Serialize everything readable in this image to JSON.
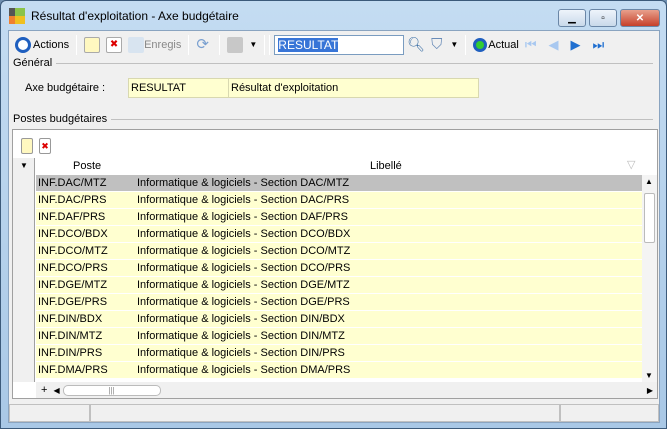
{
  "window": {
    "title": "Résultat d'exploitation -  Axe budgétaire"
  },
  "toolbar": {
    "actions": "Actions",
    "save": "Enregis",
    "search_value": "RESULTAT",
    "actual": "Actual"
  },
  "general": {
    "label": "Général",
    "axe_label": "Axe budgétaire :",
    "axe_code": "RESULTAT",
    "axe_name": "Résultat d'exploitation"
  },
  "postes": {
    "label": "Postes budgétaires",
    "columns": [
      "Poste",
      "Libellé"
    ],
    "rows": [
      [
        "INF.DAC/MTZ",
        "Informatique & logiciels - Section DAC/MTZ"
      ],
      [
        "INF.DAC/PRS",
        "Informatique & logiciels - Section DAC/PRS"
      ],
      [
        "INF.DAF/PRS",
        "Informatique & logiciels - Section DAF/PRS"
      ],
      [
        "INF.DCO/BDX",
        "Informatique & logiciels - Section DCO/BDX"
      ],
      [
        "INF.DCO/MTZ",
        "Informatique & logiciels - Section DCO/MTZ"
      ],
      [
        "INF.DCO/PRS",
        "Informatique & logiciels - Section DCO/PRS"
      ],
      [
        "INF.DGE/MTZ",
        "Informatique & logiciels - Section DGE/MTZ"
      ],
      [
        "INF.DGE/PRS",
        "Informatique & logiciels - Section DGE/PRS"
      ],
      [
        "INF.DIN/BDX",
        "Informatique & logiciels - Section DIN/BDX"
      ],
      [
        "INF.DIN/MTZ",
        "Informatique & logiciels - Section DIN/MTZ"
      ],
      [
        "INF.DIN/PRS",
        "Informatique & logiciels - Section DIN/PRS"
      ],
      [
        "INF.DMA/PRS",
        "Informatique & logiciels - Section DMA/PRS"
      ]
    ]
  }
}
